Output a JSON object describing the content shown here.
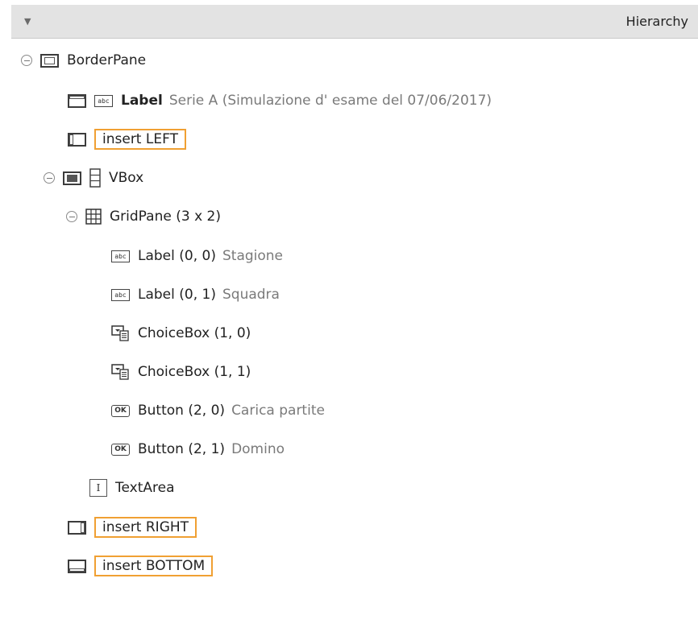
{
  "header": {
    "title": "Hierarchy",
    "caret": "▼"
  },
  "tree": {
    "border_pane": {
      "name": "BorderPane"
    },
    "label_top": {
      "name": "Label",
      "desc": "Serie A (Simulazione d' esame del 07/06/2017)"
    },
    "insert_left": {
      "label": "insert LEFT"
    },
    "vbox": {
      "name": "VBox"
    },
    "grid_pane": {
      "name": "GridPane (3 x 2)"
    },
    "label_00": {
      "name": "Label (0, 0)",
      "desc": "Stagione"
    },
    "label_01": {
      "name": "Label (0, 1)",
      "desc": "Squadra"
    },
    "choice_10": {
      "name": "ChoiceBox (1, 0)"
    },
    "choice_11": {
      "name": "ChoiceBox (1, 1)"
    },
    "button_20": {
      "name": "Button (2, 0)",
      "desc": "Carica partite"
    },
    "button_21": {
      "name": "Button (2, 1)",
      "desc": "Domino"
    },
    "text_area": {
      "name": "TextArea"
    },
    "insert_right": {
      "label": "insert RIGHT"
    },
    "insert_bottom": {
      "label": "insert BOTTOM"
    }
  },
  "icons": {
    "abc": "abc",
    "ok": "OK",
    "text": "I"
  },
  "colors": {
    "header_bg": "#e3e3e3",
    "insert_border": "#f0a033",
    "secondary_text": "#7a7a7a"
  }
}
